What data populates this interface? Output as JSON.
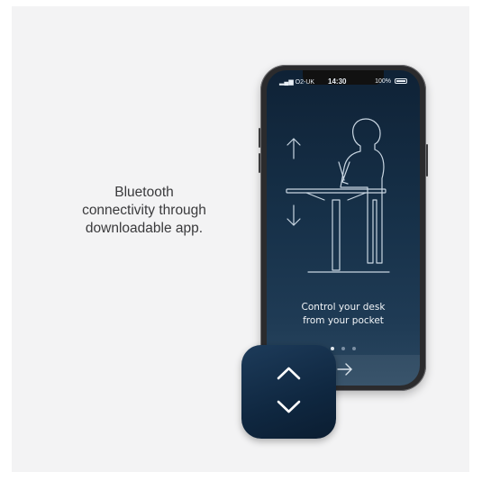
{
  "caption": {
    "line1": "Bluetooth",
    "line2": "connectivity through",
    "line3": "downloadable app."
  },
  "phone": {
    "status_bar": {
      "carrier": "O2-UK",
      "time": "14:30",
      "battery_percent": "100%"
    },
    "onboarding": {
      "tagline_line1": "Control your desk",
      "tagline_line2": "from your pocket",
      "page_count": 3,
      "active_page": 1,
      "next_icon": "arrow-right-icon"
    },
    "illustration_icons": [
      "arrow-up-icon",
      "arrow-down-icon",
      "standing-desk-person-illustration"
    ]
  },
  "app_icon": {
    "icons": [
      "chevron-up-icon",
      "chevron-down-icon"
    ]
  },
  "colors": {
    "background": "#f3f3f4",
    "screen_top": "#0f2236",
    "screen_bottom": "#2a4760",
    "app_icon": "#0f2740",
    "line_art": "#c9d6e2"
  }
}
